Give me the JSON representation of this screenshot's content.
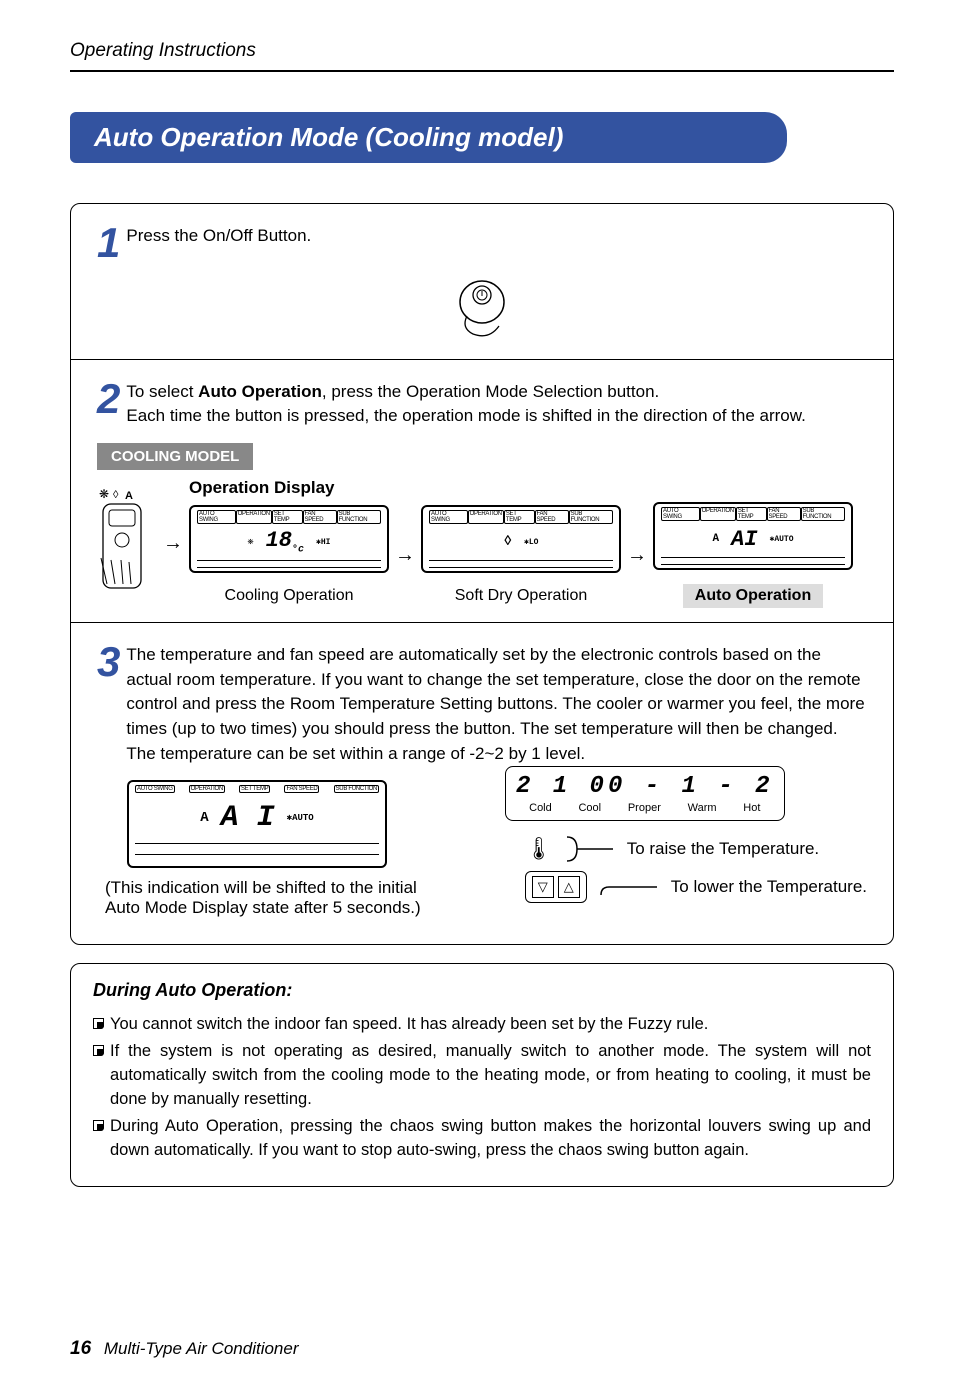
{
  "header": {
    "section": "Operating Instructions"
  },
  "title": "Auto Operation Mode (Cooling model)",
  "step1": {
    "num": "1",
    "text": "Press the On/Off Button."
  },
  "step2": {
    "num": "2",
    "line1": "To select ",
    "bold": "Auto Operation",
    "line1b": ", press the Operation Mode Selection button.",
    "line2": "Each time the button is pressed, the operation mode is shifted in the direction of the arrow."
  },
  "cooling_badge": "COOLING MODEL",
  "op_display_label": "Operation Display",
  "display_tabs": {
    "a": "AUTO SWING",
    "b": "OPERATION",
    "c": "SET TEMP",
    "d": "FAN SPEED",
    "e": "SUB FUNCTION"
  },
  "display1": {
    "main": "18",
    "unit": "°c",
    "fan": "HI"
  },
  "display2": {
    "icon": "◊",
    "fan": "LO"
  },
  "display3": {
    "icon": "A",
    "main": "AI",
    "fan": "AUTO"
  },
  "captions": {
    "cooling": "Cooling Operation",
    "softdry": "Soft Dry Operation",
    "auto": "Auto Operation"
  },
  "step3": {
    "num": "3",
    "text": "The temperature and fan speed are automatically set by the electronic controls based on the actual room temperature. If you want to change the set temperature, close the door on the remote control and press the Room Temperature Setting buttons. The cooler or warmer you feel, the more times (up to two times) you should press the button. The set temperature will then be changed.",
    "text2": "The temperature can be set within a range of -2~2 by 1 level."
  },
  "ai_display": {
    "main": "A I",
    "fan": "AUTO"
  },
  "note_paren": "(This indication will be shifted to the initial Auto Mode Display state after 5 seconds.)",
  "scale": {
    "digits": "2  1  00 - 1 - 2",
    "l1": "Cold",
    "l2": "Cool",
    "l3": "Proper",
    "l4": "Warm",
    "l5": "Hot"
  },
  "temp_raise": "To raise the Temperature.",
  "temp_lower": "To lower the Temperature.",
  "during": {
    "title": "During Auto Operation:",
    "b1": "You cannot switch the indoor fan speed. It has already been set by the Fuzzy rule.",
    "b2": "If the system is not operating as desired, manually switch to another mode. The system will not automatically switch from the cooling mode to the heating mode, or from heating to cooling, it must be done by manually resetting.",
    "b3": "During Auto Operation, pressing the chaos swing button makes the horizontal louvers swing up and down automatically. If you want to stop auto-swing, press the chaos swing button again."
  },
  "footer": {
    "page": "16",
    "title": "Multi-Type Air Conditioner"
  }
}
